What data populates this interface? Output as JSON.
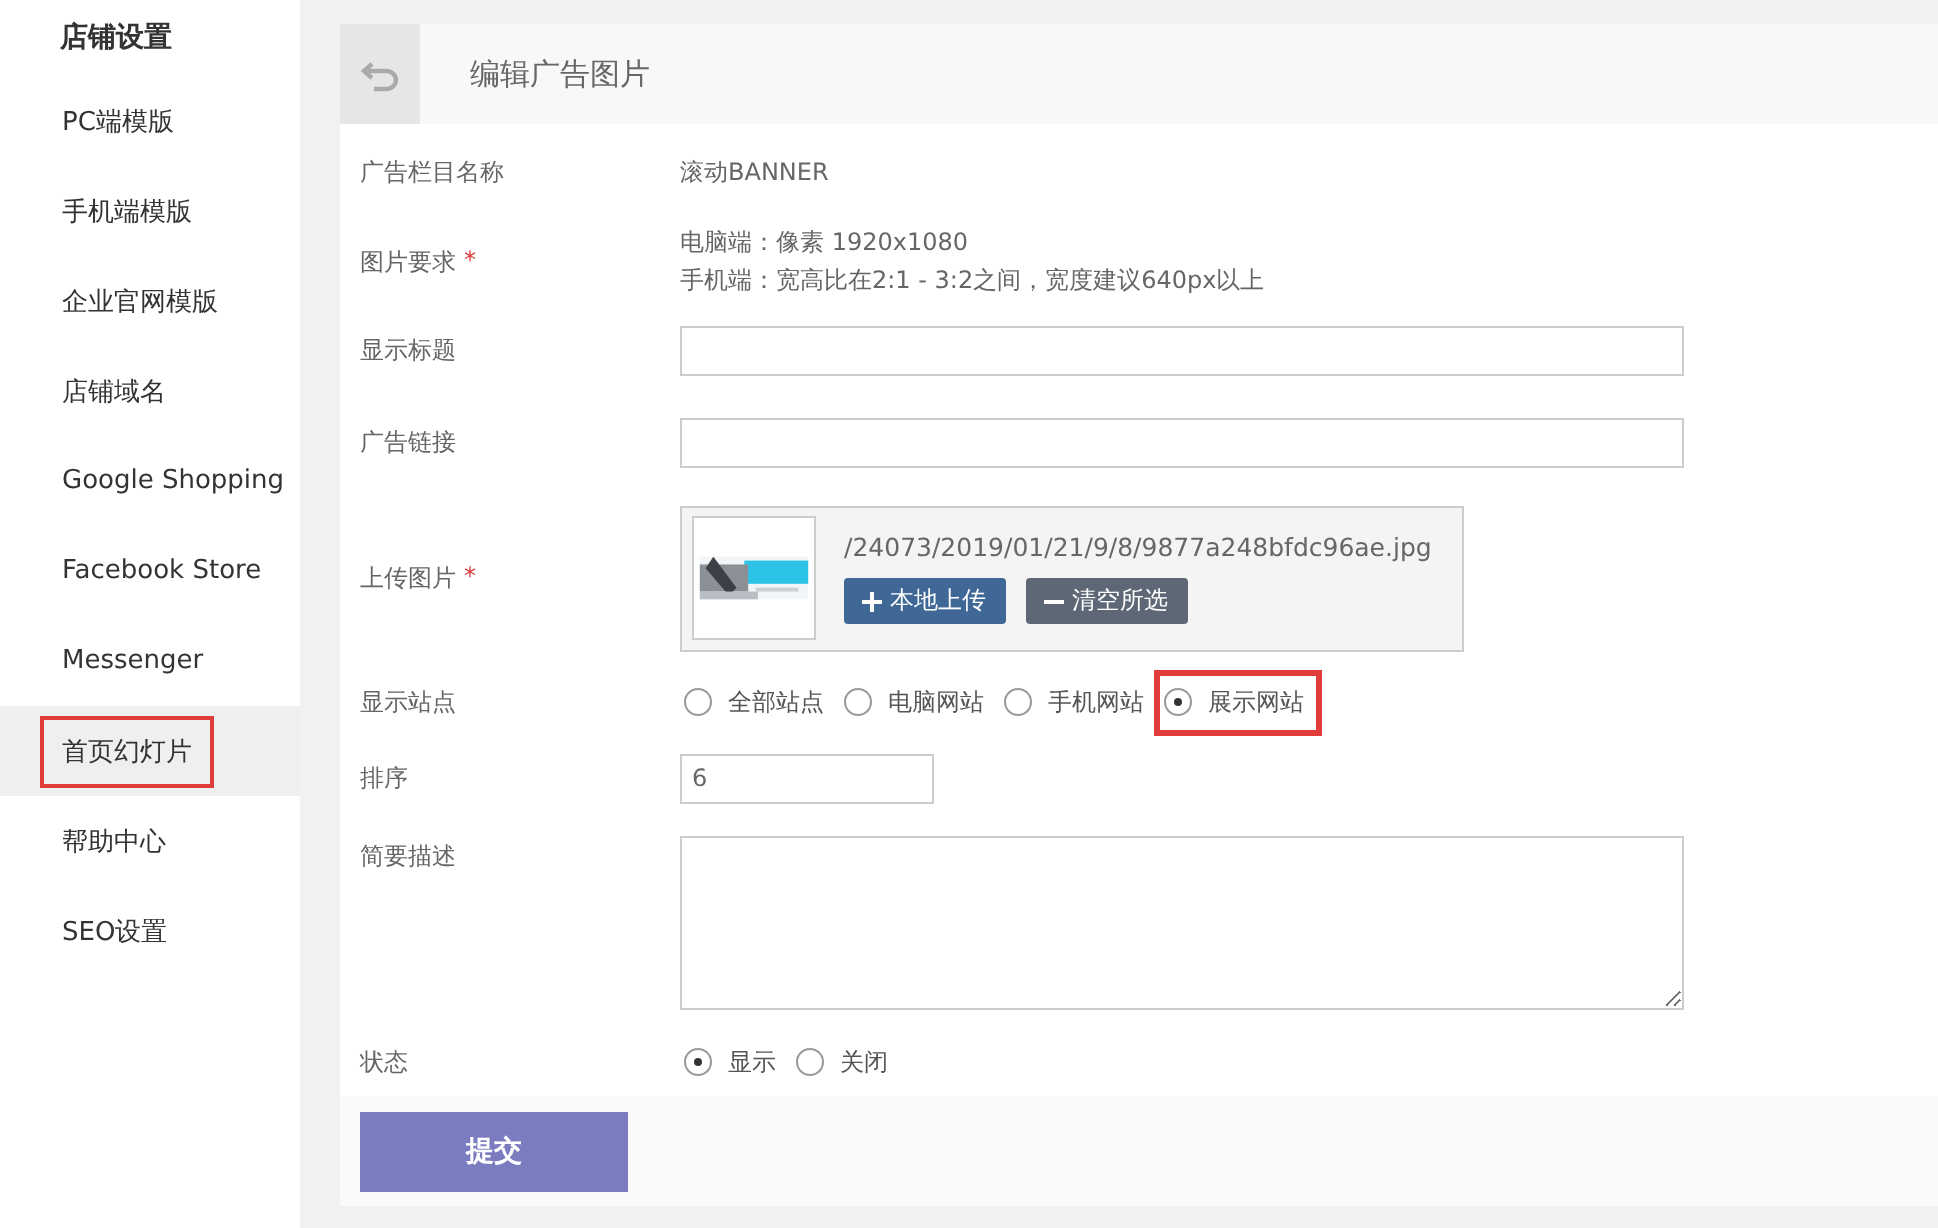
{
  "sidebar": {
    "title": "店铺设置",
    "items": [
      {
        "label": "PC端模版",
        "selected": false,
        "highlighted": false
      },
      {
        "label": "手机端模版",
        "selected": false,
        "highlighted": false
      },
      {
        "label": "企业官网模版",
        "selected": false,
        "highlighted": false
      },
      {
        "label": "店铺域名",
        "selected": false,
        "highlighted": false
      },
      {
        "label": "Google Shopping",
        "selected": false,
        "highlighted": false
      },
      {
        "label": "Facebook Store",
        "selected": false,
        "highlighted": false
      },
      {
        "label": "Messenger",
        "selected": false,
        "highlighted": false
      },
      {
        "label": "首页幻灯片",
        "selected": true,
        "highlighted": true
      },
      {
        "label": "帮助中心",
        "selected": false,
        "highlighted": false
      },
      {
        "label": "SEO设置",
        "selected": false,
        "highlighted": false
      }
    ]
  },
  "header": {
    "title": "编辑广告图片"
  },
  "form": {
    "rows": [
      {
        "kind": "text",
        "label": "广告栏目名称",
        "value": "滚动BANNER"
      },
      {
        "kind": "lines",
        "label": "图片要求",
        "required_mark": "*",
        "lines": [
          "电脑端：像素 1920x1080",
          "手机端：宽高比在2:1 - 3:2之间，宽度建议640px以上"
        ]
      },
      {
        "kind": "input",
        "label": "显示标题"
      },
      {
        "kind": "input",
        "label": "广告链接"
      },
      {
        "kind": "upload",
        "label": "上传图片",
        "required_mark": "*",
        "path": "/24073/2019/01/21/9/8/9877a248bfdc96ae.jpg",
        "buttons": [
          {
            "label": "本地上传",
            "kind": "add"
          },
          {
            "label": "清空所选",
            "kind": "clear"
          }
        ]
      },
      {
        "kind": "radios",
        "label": "显示站点",
        "options": [
          {
            "label": "全部站点",
            "selected": false,
            "highlighted": false
          },
          {
            "label": "电脑网站",
            "selected": false,
            "highlighted": false
          },
          {
            "label": "手机网站",
            "selected": false,
            "highlighted": false
          },
          {
            "label": "展示网站",
            "selected": true,
            "highlighted": true
          }
        ]
      },
      {
        "kind": "short-input",
        "label": "排序",
        "value": "6"
      },
      {
        "kind": "textarea",
        "label": "简要描述"
      },
      {
        "kind": "radios",
        "label": "状态",
        "options": [
          {
            "label": "显示",
            "selected": true,
            "highlighted": false
          },
          {
            "label": "关闭",
            "selected": false,
            "highlighted": false
          }
        ]
      }
    ]
  },
  "submit": {
    "label": "提交"
  }
}
